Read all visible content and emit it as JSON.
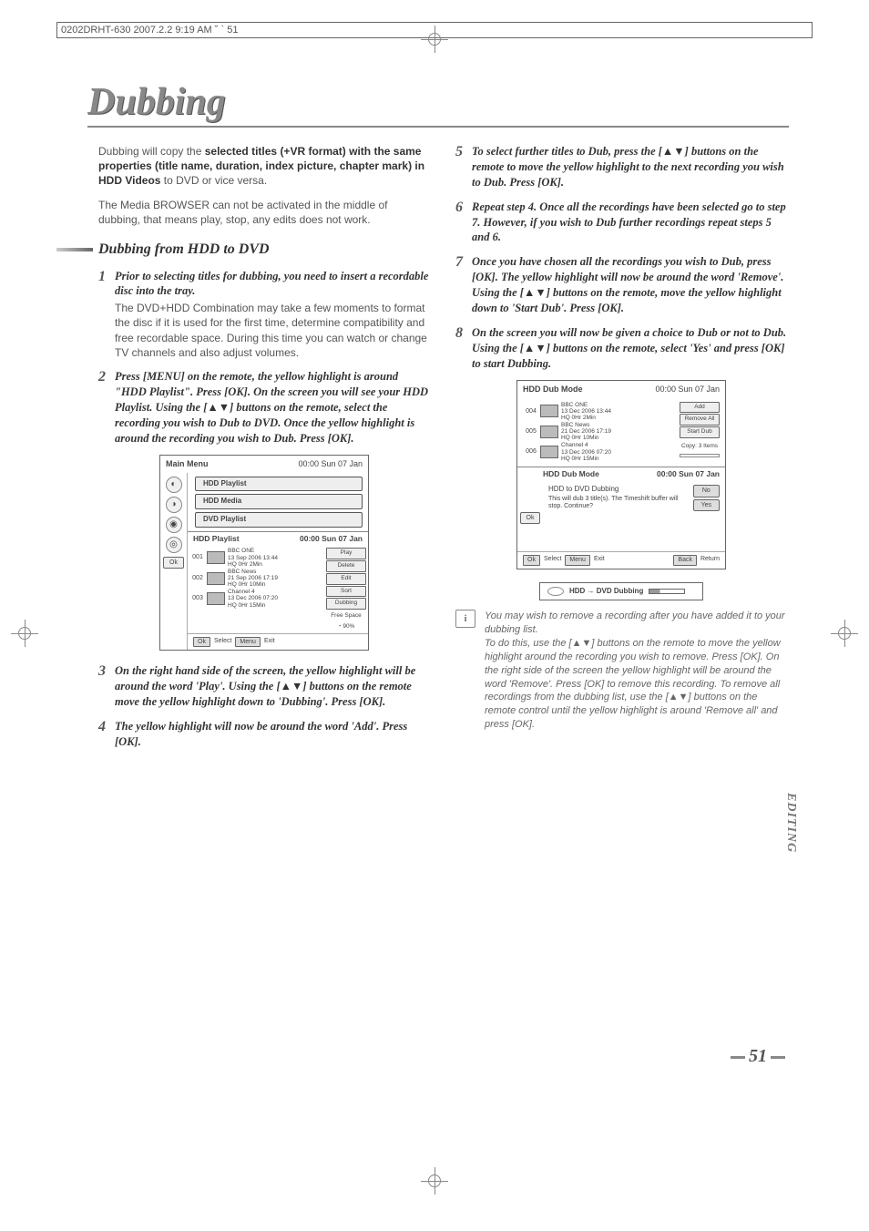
{
  "header_line": "0202DRHT-630  2007.2.2 9:19 AM  ˘ ` 51",
  "page_title": "Dubbing",
  "intro_pre": "Dubbing will copy the ",
  "intro_bold": "selected titles (+VR format) with the same properties (title name, duration, index picture, chapter mark) in HDD Videos",
  "intro_post": " to DVD or vice versa.",
  "intro_p2": "The Media BROWSER can not be activated in the middle of dubbing, that means play, stop, any edits does not work.",
  "section_heading": "Dubbing from HDD to DVD",
  "steps_left": [
    {
      "num": "1",
      "title": "Prior to selecting titles for dubbing, you need to insert a recordable disc into the tray.",
      "body": "The DVD+HDD Combination may take a few moments to format the disc if it is used for the first time, determine compatibility and free recordable space. During this time you can watch or change TV channels and also adjust volumes."
    },
    {
      "num": "2",
      "title": "Press [MENU] on the remote, the yellow highlight is around \"HDD Playlist\". Press [OK]. On the screen you will see your HDD Playlist. Using the [▲▼]  buttons on the remote, select  the recording you wish to Dub to DVD. Once the yellow highlight is around the recording you wish to Dub. Press [OK].",
      "body": ""
    },
    {
      "num": "3",
      "title": " On the right hand side of the screen, the yellow highlight will be around the word 'Play'. Using the [▲▼] buttons on the remote move the yellow highlight down to 'Dubbing'. Press [OK].",
      "body": ""
    },
    {
      "num": "4",
      "title": " The yellow highlight will now be around the word 'Add'. Press [OK].",
      "body": ""
    }
  ],
  "steps_right": [
    {
      "num": "5",
      "title": " To select further titles to Dub, press the [▲▼] buttons on the remote to move the yellow highlight to the next recording you wish to Dub. Press [OK]."
    },
    {
      "num": "6",
      "title": " Repeat step 4. Once all the recordings have been selected go to step 7. However, if you wish to Dub further recordings  repeat steps 5 and 6."
    },
    {
      "num": "7",
      "title": " Once you have chosen all the recordings you wish to Dub, press [OK]. The yellow highlight will now be around the word 'Remove'. Using the [▲▼] buttons on the remote, move the yellow highlight down to 'Start Dub'. Press [OK]."
    },
    {
      "num": "8",
      "title": " On the screen you will now be given a choice to Dub or not to Dub. Using the [▲▼] buttons on the remote, select 'Yes' and press [OK] to start Dubbing."
    }
  ],
  "fig1": {
    "title": "Main Menu",
    "time": "00:00 Sun 07 Jan",
    "btns": [
      "HDD Playlist",
      "HDD Media",
      "DVD Playlist"
    ],
    "sub_title": "HDD Playlist",
    "sub_time": "00:00 Sun 07 Jan",
    "ok": "Ok",
    "rows": [
      {
        "idx": "001",
        "t1": "BBC ONE",
        "t2": "13 Sep 2006 13:44",
        "t3": "HQ  0Hr  2Min"
      },
      {
        "idx": "002",
        "t1": "BBC News",
        "t2": "21 Sep 2006 17:19",
        "t3": "HQ  0Hr  10Min"
      },
      {
        "idx": "003",
        "t1": "Channel 4",
        "t2": "13 Dec 2006 07:20",
        "t3": "HQ  0Hr  15Min"
      }
    ],
    "actions": [
      "Play",
      "Delete",
      "Edit",
      "Sort",
      "Dubbing"
    ],
    "free_label": "Free Space",
    "free_val": "90%",
    "ctrl_ok": "Ok",
    "ctrl_select": "Select",
    "ctrl_menu": "Menu",
    "ctrl_exit": "Exit"
  },
  "fig2": {
    "title": "HDD Dub Mode",
    "time": "00:00 Sun 07 Jan",
    "rows": [
      {
        "idx": "004",
        "t1": "BBC ONE",
        "t2": "13 Dec 2006 13:44",
        "t3": "HQ  0Hr  2Min"
      },
      {
        "idx": "005",
        "t1": "BBC News",
        "t2": "21 Dec 2006 17:19",
        "t3": "HQ  0Hr  10Min"
      },
      {
        "idx": "006",
        "t1": "Channel 4",
        "t2": "13 Dec 2006 07:20",
        "t3": "HQ  0Hr  15Min"
      }
    ],
    "actions": [
      "Add",
      "Remove All",
      "Start Dub"
    ],
    "copy_label": "Copy: 3 Items",
    "sub_title": "HDD Dub Mode",
    "sub_time": "00:00 Sun 07 Jan",
    "ok": "Ok",
    "dialog_title": "HDD to DVD Dubbing",
    "dialog_text": "This will dub 3 title(s). The Timeshift buffer will stop. Continue?",
    "no": "No",
    "yes": "Yes",
    "ctrl_ok": "Ok",
    "ctrl_select": "Select",
    "ctrl_menu": "Menu",
    "ctrl_exit": "Exit",
    "ctrl_back": "Back",
    "ctrl_return": "Return",
    "progress_label": "HDD → DVD Dubbing"
  },
  "note_p1": "You may wish to remove a recording after you have added it to your dubbing list.",
  "note_p2": "To do this, use the [▲▼] buttons on the remote to move the yellow highlight around the recording you wish to remove. Press [OK]. On the right side of the screen the yellow highlight will be around the word 'Remove'. Press [OK] to remove this recording. To remove all recordings from the dubbing list, use the [▲▼] buttons on the remote control until the yellow highlight is around 'Remove all' and press [OK].",
  "side_tab": "EDITING",
  "page_number": "51"
}
